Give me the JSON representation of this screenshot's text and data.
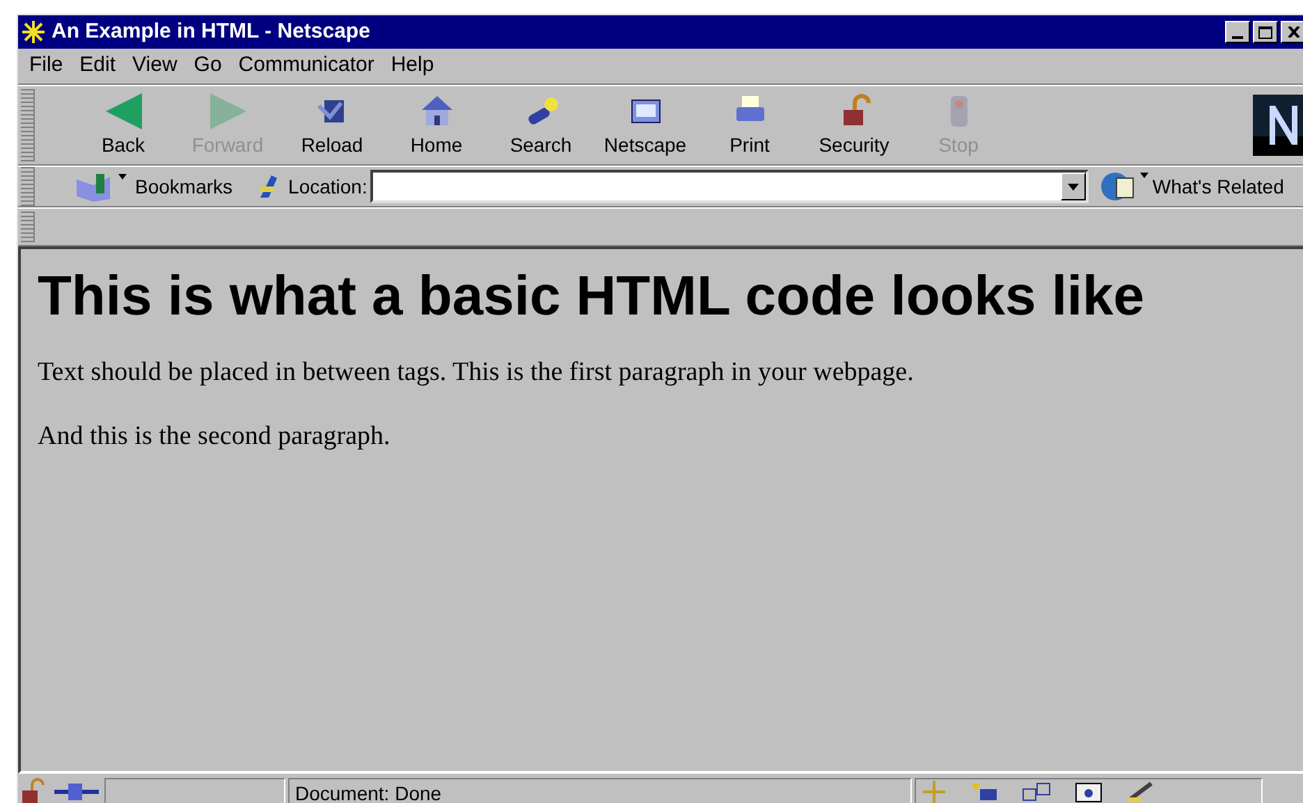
{
  "window": {
    "title": "An Example in HTML - Netscape"
  },
  "menu": [
    "File",
    "Edit",
    "View",
    "Go",
    "Communicator",
    "Help"
  ],
  "toolbar": [
    {
      "label": "Back",
      "disabled": false
    },
    {
      "label": "Forward",
      "disabled": true
    },
    {
      "label": "Reload",
      "disabled": false
    },
    {
      "label": "Home",
      "disabled": false
    },
    {
      "label": "Search",
      "disabled": false
    },
    {
      "label": "Netscape",
      "disabled": false
    },
    {
      "label": "Print",
      "disabled": false
    },
    {
      "label": "Security",
      "disabled": false
    },
    {
      "label": "Stop",
      "disabled": true
    }
  ],
  "location_bar": {
    "bookmarks": "Bookmarks",
    "location_label": "Location:",
    "whats_related": "What's Related"
  },
  "page": {
    "heading": "This is what a basic HTML code looks like",
    "paragraphs": [
      "Text should be placed in between tags. This is the first paragraph in your webpage.",
      "And this is the second paragraph."
    ]
  },
  "status_bar": {
    "text": "Document: Done"
  }
}
